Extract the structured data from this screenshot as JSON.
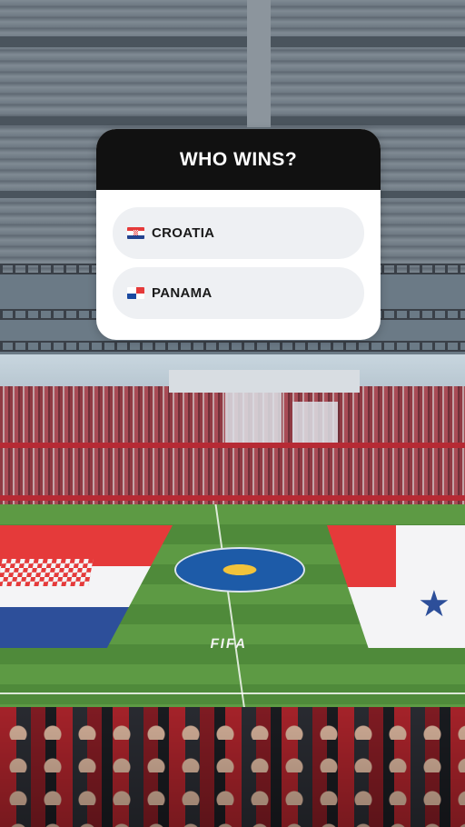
{
  "story": {
    "background": "stadium-photo",
    "poll": {
      "question": "WHO WINS?",
      "options": [
        {
          "label": "CROATIA",
          "flag_icon": "croatia-flag-icon"
        },
        {
          "label": "PANAMA",
          "flag_icon": "panama-flag-icon"
        }
      ]
    },
    "pitch_text": "FIFA"
  },
  "colors": {
    "poll_header": "#111111",
    "poll_body": "#ffffff",
    "option_bg": "#eef0f3",
    "croatia_red": "#e53a3a",
    "croatia_blue": "#23438f",
    "panama_blue": "#1b4aa0"
  }
}
